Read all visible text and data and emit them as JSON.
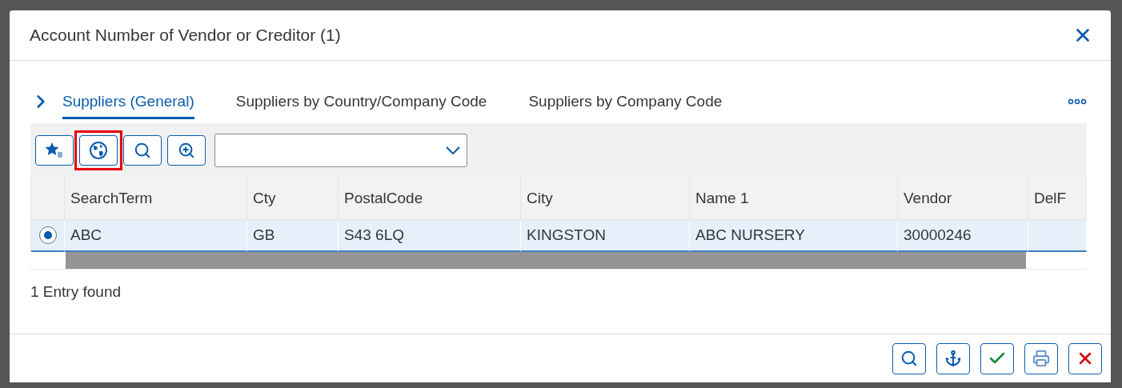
{
  "dialog": {
    "title": "Account Number of Vendor or Creditor (1)"
  },
  "tabs": [
    {
      "label": "Suppliers (General)",
      "selected": true
    },
    {
      "label": "Suppliers by Country/Company Code",
      "selected": false
    },
    {
      "label": "Suppliers by Company Code",
      "selected": false
    }
  ],
  "toolbar": {
    "buttons": [
      {
        "kind": "favorites",
        "highlighted": false
      },
      {
        "kind": "globe",
        "highlighted": true
      },
      {
        "kind": "search",
        "highlighted": false
      },
      {
        "kind": "search-plus",
        "highlighted": false
      }
    ]
  },
  "table": {
    "columns": [
      "SearchTerm",
      "Cty",
      "PostalCode",
      "City",
      "Name 1",
      "Vendor",
      "DelF"
    ],
    "rows": [
      {
        "selected": true,
        "cells": [
          "ABC",
          "GB",
          "S43 6LQ",
          "KINGSTON",
          "ABC NURSERY",
          "30000246",
          ""
        ]
      }
    ]
  },
  "status": "1 Entry found",
  "footer_buttons": [
    {
      "kind": "search"
    },
    {
      "kind": "anchor"
    },
    {
      "kind": "confirm"
    },
    {
      "kind": "print"
    },
    {
      "kind": "cancel"
    }
  ]
}
